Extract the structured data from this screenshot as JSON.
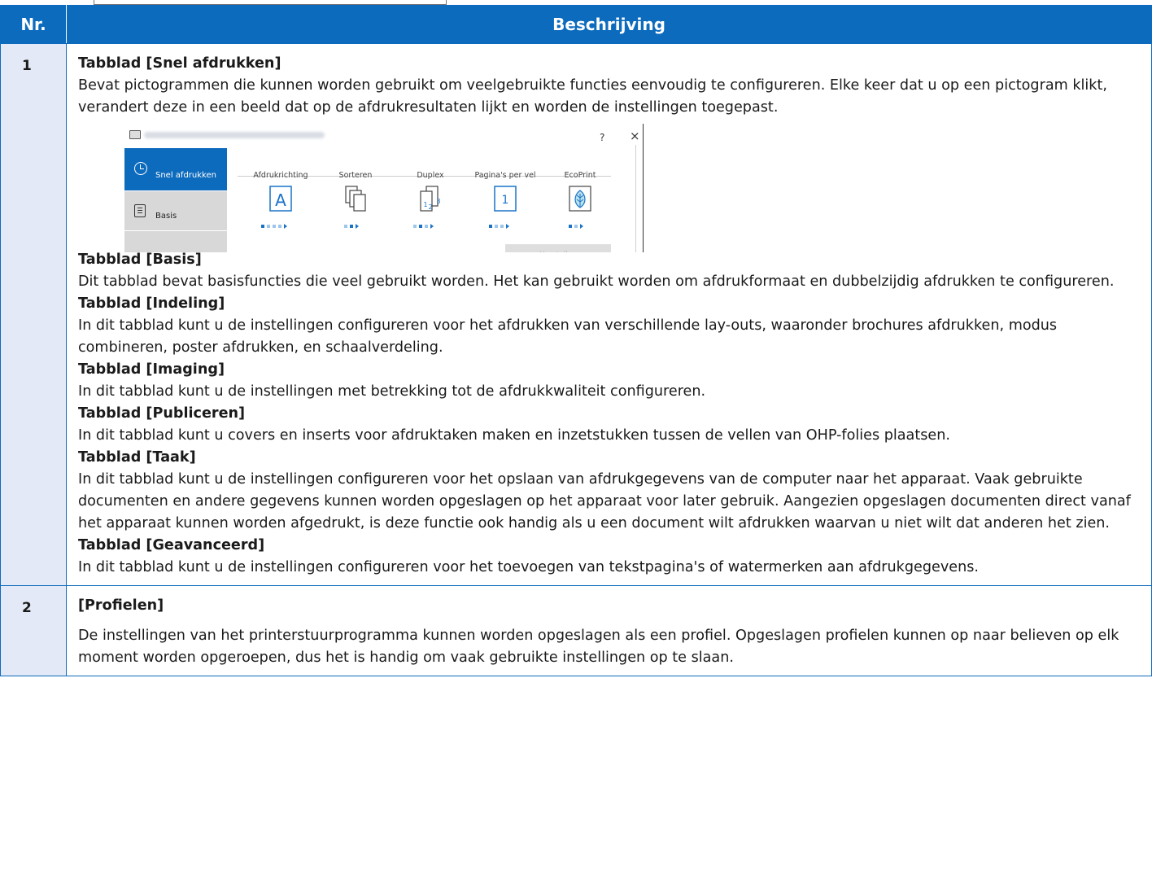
{
  "table": {
    "headers": {
      "nr": "Nr.",
      "description": "Beschrijving"
    },
    "rows": [
      {
        "nr": "1",
        "sections": [
          {
            "heading": "Tabblad [Snel afdrukken]",
            "text": "Bevat pictogrammen die kunnen worden gebruikt om veelgebruikte functies eenvoudig te configureren. Elke keer dat u op een pictogram klikt, verandert deze in een beeld dat op de afdrukresultaten lijkt en worden de instellingen toegepast."
          },
          {
            "heading": "Tabblad [Basis]",
            "text": "Dit tabblad bevat basisfuncties die veel gebruikt worden. Het kan gebruikt worden om afdrukformaat en dubbelzijdig afdrukken te configureren."
          },
          {
            "heading": "Tabblad [Indeling]",
            "text": "In dit tabblad kunt u de instellingen configureren voor het afdrukken van verschillende lay-outs, waaronder brochures afdrukken, modus combineren, poster afdrukken, en schaalverdeling."
          },
          {
            "heading": "Tabblad [Imaging]",
            "text": "In dit tabblad kunt u de instellingen met betrekking tot de afdrukkwaliteit configureren."
          },
          {
            "heading": "Tabblad [Publiceren]",
            "text": "In dit tabblad kunt u covers en inserts voor afdruktaken maken en inzetstukken tussen de vellen van OHP-folies plaatsen."
          },
          {
            "heading": "Tabblad [Taak]",
            "text": "In dit tabblad kunt u de instellingen configureren voor het opslaan van afdrukgegevens van de computer naar het apparaat. Vaak gebruikte documenten en andere gegevens kunnen worden opgeslagen op het apparaat voor later gebruik. Aangezien opgeslagen documenten direct vanaf het apparaat kunnen worden afgedrukt, is deze functie ook handig als u een document wilt afdrukken waarvan u niet wilt dat anderen het zien."
          },
          {
            "heading": "Tabblad [Geavanceerd]",
            "text": "In dit tabblad kunt u de instellingen configureren voor het toevoegen van tekstpagina's of watermerken aan afdrukgegevens."
          }
        ]
      },
      {
        "nr": "2",
        "sections": [
          {
            "heading": "[Profielen]",
            "text": "De instellingen van het printerstuurprogramma kunnen worden opgeslagen als een profiel. Opgeslagen profielen kunnen op naar believen op elk moment worden opgeroepen, dus het is handig om vaak gebruikte instellingen op te slaan."
          }
        ]
      }
    ]
  },
  "screenshot": {
    "help": "?",
    "close": "×",
    "sidebar": {
      "active": "Snel afdrukken",
      "second": "Basis"
    },
    "features": [
      "Afdrukrichting",
      "Sorteren",
      "Duplex",
      "Pagina's per vel",
      "EcoPrint"
    ],
    "icon_glyphs": {
      "orientation": "A",
      "pages_per_sheet": "1",
      "duplex_pages": [
        "1",
        "2",
        "3"
      ]
    },
    "reset": "Herstellen"
  },
  "colors": {
    "accent": "#0d6bbd",
    "nr_background": "#e3e9f7"
  }
}
